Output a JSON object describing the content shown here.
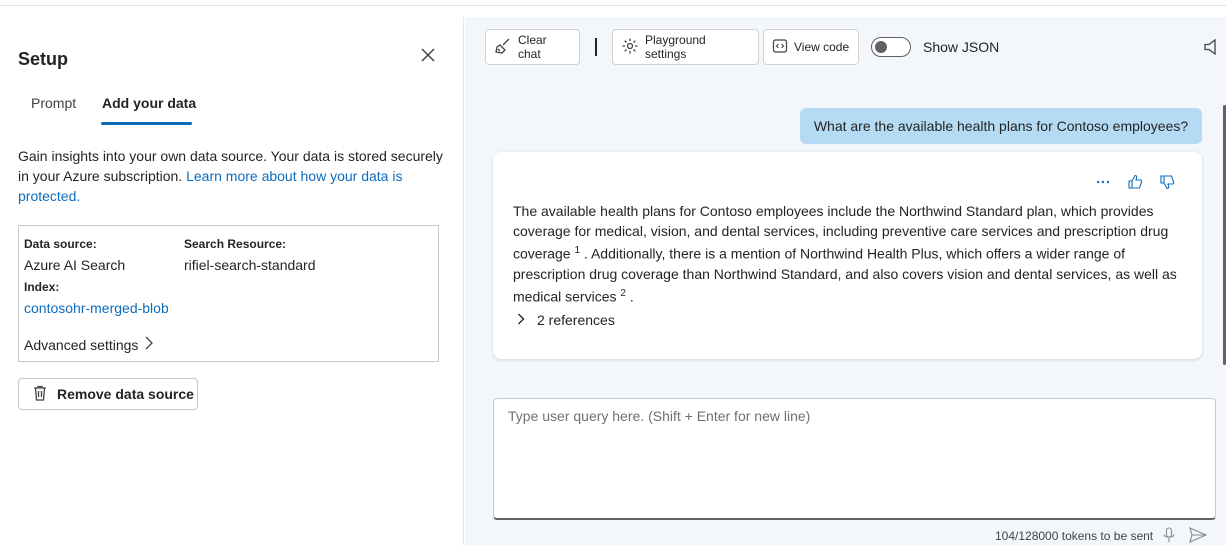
{
  "setup": {
    "title": "Setup",
    "tabs": [
      {
        "label": "Prompt"
      },
      {
        "label": "Add your data"
      }
    ],
    "description": "Gain insights into your own data source. Your data is stored securely in your Azure subscription. ",
    "learn_more_link": "Learn more about how your data is protected.",
    "data_source": {
      "data_source_label": "Data source:",
      "data_source_value": "Azure AI Search",
      "search_resource_label": "Search Resource:",
      "search_resource_value": "rifiel-search-standard",
      "index_label": "Index:",
      "index_value": "contosohr-merged-blob",
      "advanced_settings": "Advanced settings"
    },
    "remove_button": "Remove data source"
  },
  "toolbar": {
    "clear_chat": "Clear chat",
    "playground_settings": "Playground settings",
    "view_code": "View code",
    "show_json": "Show JSON"
  },
  "chat": {
    "user_message": "What are the available health plans for Contoso employees?",
    "response_part1": "The available health plans for Contoso employees include the Northwind Standard plan, which provides coverage for medical, vision, and dental services, including preventive care services and prescription drug coverage ",
    "citation1": "1",
    "response_part2": " . Additionally, there is a mention of Northwind Health Plus, which offers a wider range of prescription drug coverage than Northwind Standard, and also covers vision and dental services, as well as medical services ",
    "citation2": "2",
    "response_part3": " .",
    "references": "2 references"
  },
  "input": {
    "placeholder": "Type user query here. (Shift + Enter for new line)",
    "tokens": "104/128000 tokens to be sent"
  },
  "colors": {
    "accent": "#0f6cbd",
    "user_bubble": "#b5dbf4",
    "chat_bg": "#f3f6fb"
  }
}
